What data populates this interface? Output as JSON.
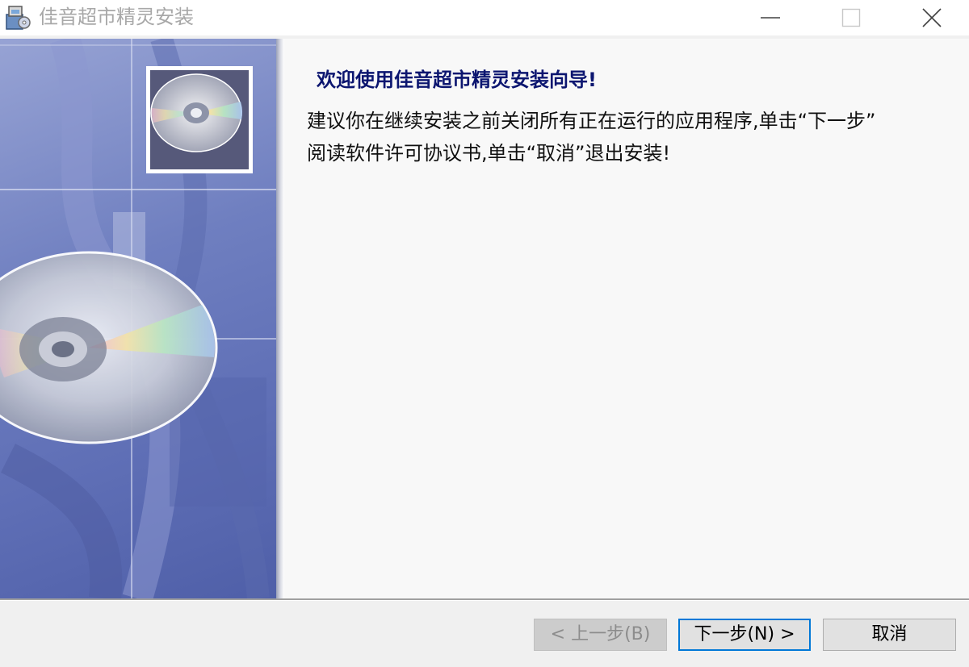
{
  "window": {
    "title": "佳音超市精灵安装",
    "app_icon": "installer-icon",
    "controls": {
      "minimize_icon": "minimize-icon",
      "maximize_icon": "maximize-icon",
      "close_icon": "close-icon"
    }
  },
  "banner": {
    "image": "cd-disc-banner-image"
  },
  "wizard": {
    "heading": "欢迎使用佳音超市精灵安装向导!",
    "body_line1": "建议你在继续安装之前关闭所有正在运行的应用程序,单击“下一步”",
    "body_line2": "阅读软件许可协议书,单击“取消”退出安装!"
  },
  "buttons": {
    "back_label": "< 上一步(B)",
    "next_label": "下一步(N) >",
    "cancel_label": "取消",
    "back_enabled": false
  },
  "colors": {
    "heading": "#0c1670",
    "focus_border": "#0078d7",
    "banner_blue": "#6f7fc0"
  }
}
